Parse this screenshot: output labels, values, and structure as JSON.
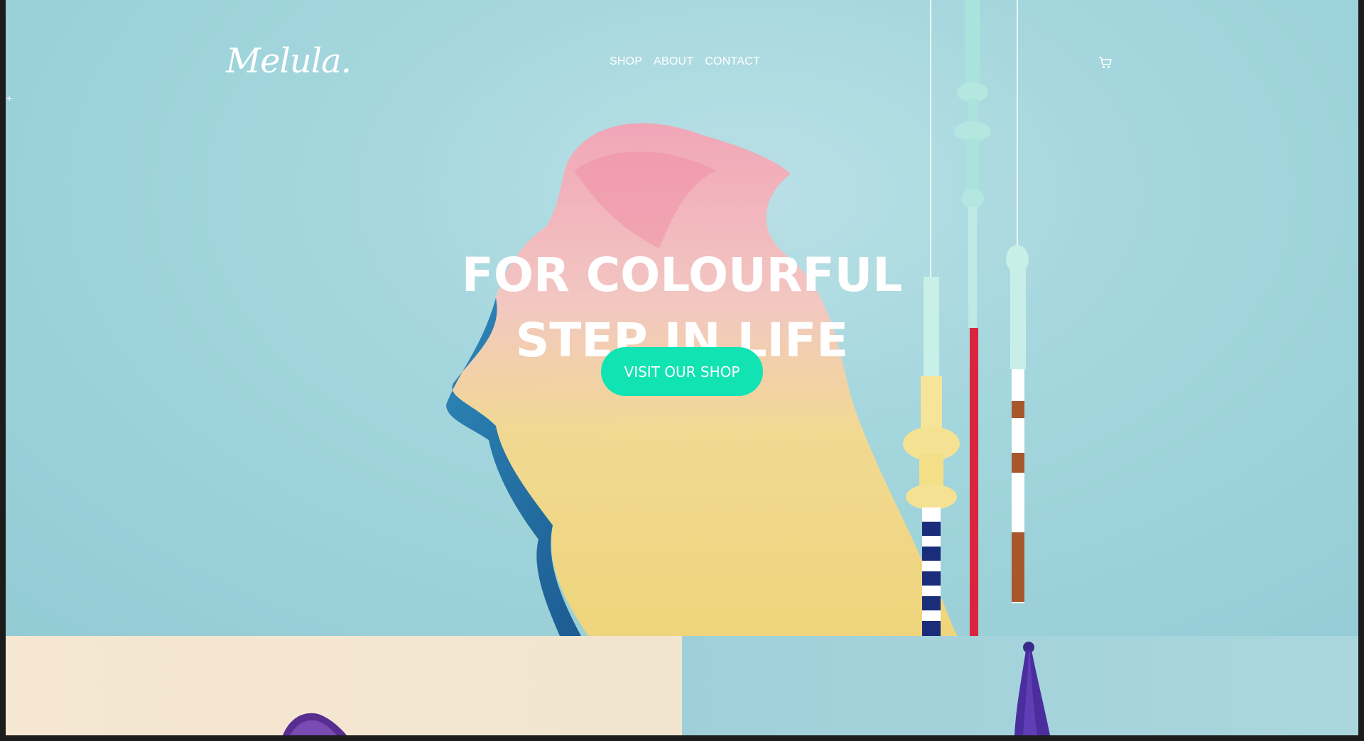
{
  "header": {
    "logo": "Melula.",
    "nav": [
      "SHOP",
      "ABOUT",
      "CONTACT"
    ],
    "cart_icon": "cart-icon"
  },
  "hero": {
    "title_line1": "FOR COLOURFUL",
    "title_line2": "STEP IN LIFE",
    "cta_label": "VISIT OUR SHOP"
  },
  "colors": {
    "background": "#9dd2da",
    "cta": "#12e3b3",
    "text": "#ffffff",
    "tile_left": "#f5e7d2",
    "tile_right": "#9fd0d9"
  }
}
